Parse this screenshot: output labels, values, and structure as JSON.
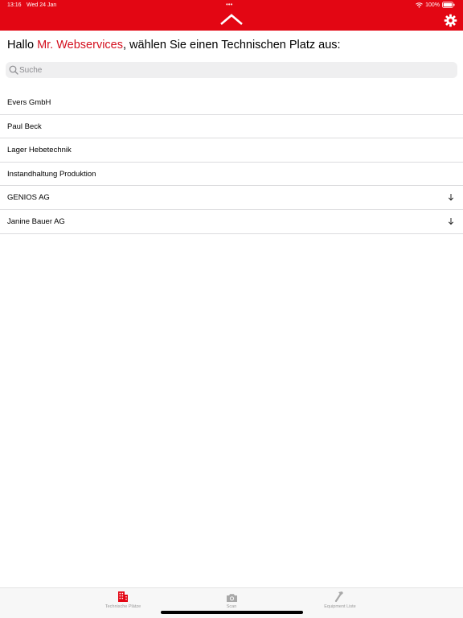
{
  "status_bar": {
    "time": "13:16",
    "date": "Wed 24 Jan",
    "battery": "100%",
    "multitask_dots": "•••"
  },
  "header": {
    "background_color": "#e30613",
    "logo_icon": "roof-logo-icon",
    "settings_icon": "gear-icon"
  },
  "greeting": {
    "prefix": "Hallo ",
    "name": "Mr. Webservices",
    "suffix": ", wählen Sie einen Technischen Platz aus:",
    "name_color": "#d4101f"
  },
  "search": {
    "placeholder": "Suche",
    "value": ""
  },
  "list": {
    "items": [
      {
        "label": "Evers GmbH",
        "expandable": false
      },
      {
        "label": "Paul Beck",
        "expandable": false
      },
      {
        "label": "Lager Hebetechnik",
        "expandable": false
      },
      {
        "label": "Instandhaltung Produktion",
        "expandable": false
      },
      {
        "label": "GENIOS AG",
        "expandable": true
      },
      {
        "label": "Janine Bauer AG",
        "expandable": true
      }
    ]
  },
  "tabbar": {
    "tabs": [
      {
        "label": "Technische Plätze",
        "icon": "building-icon",
        "active": true
      },
      {
        "label": "Scan",
        "icon": "camera-icon",
        "active": false
      },
      {
        "label": "Equipment Liste",
        "icon": "hammer-icon",
        "active": false
      }
    ],
    "active_color": "#e30613"
  }
}
